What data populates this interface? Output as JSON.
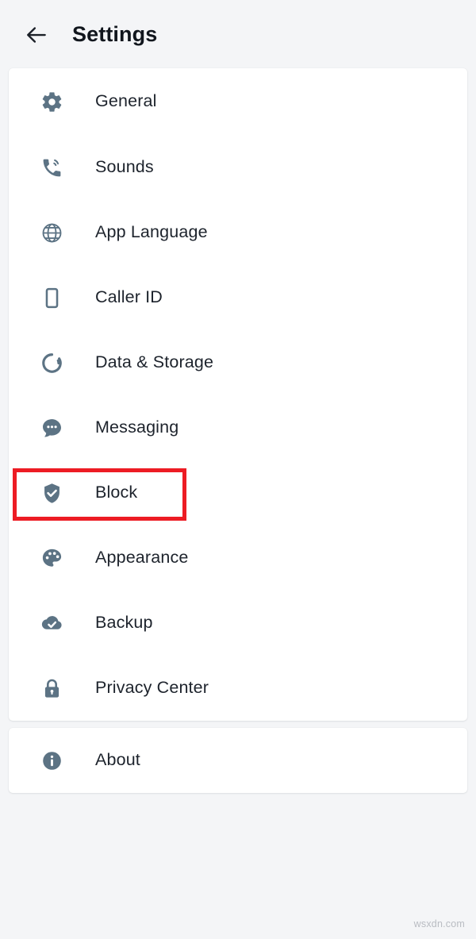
{
  "header": {
    "back_icon": "arrow-left-icon",
    "title": "Settings"
  },
  "colors": {
    "page_background": "#f4f5f7",
    "card_background": "#ffffff",
    "icon": "#5c7384",
    "label_text": "#1d232c",
    "title_text": "#11161d",
    "annotation": "#ed1c24"
  },
  "sections": [
    {
      "id": "main-settings",
      "items": [
        {
          "label": "General",
          "icon": "gear-icon"
        },
        {
          "label": "Sounds",
          "icon": "phone-ring-volume-icon"
        },
        {
          "label": "App Language",
          "icon": "globe-icon"
        },
        {
          "label": "Caller ID",
          "icon": "smartphone-icon"
        },
        {
          "label": "Data & Storage",
          "icon": "data-usage-donut-icon"
        },
        {
          "label": "Messaging",
          "icon": "chat-bubble-icon"
        },
        {
          "label": "Block",
          "icon": "shield-check-icon"
        },
        {
          "label": "Appearance",
          "icon": "palette-icon"
        },
        {
          "label": "Backup",
          "icon": "cloud-check-icon"
        },
        {
          "label": "Privacy Center",
          "icon": "lock-icon"
        }
      ]
    },
    {
      "id": "about-section",
      "items": [
        {
          "label": "About",
          "icon": "info-circle-icon"
        }
      ]
    }
  ],
  "annotation": {
    "type": "highlight-rectangle",
    "target_label": "Block",
    "color": "#ed1c24"
  },
  "watermark": {
    "text": "wsxdn.com"
  }
}
